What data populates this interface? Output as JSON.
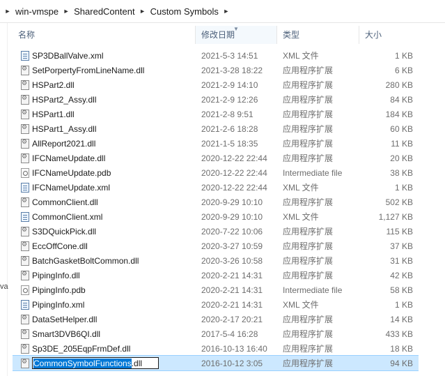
{
  "breadcrumb": [
    "win-vmspe",
    "SharedContent",
    "Custom Symbols"
  ],
  "left_fragment": "va",
  "columns": {
    "name": "名称",
    "date": "修改日期",
    "type": "类型",
    "size": "大小"
  },
  "files": [
    {
      "name": "SP3DBallValve.xml",
      "date": "2021-5-3 14:51",
      "type": "XML 文件",
      "size": "1 KB",
      "icon": "xml"
    },
    {
      "name": "SetPorpertyFromLineName.dll",
      "date": "2021-3-28 18:22",
      "type": "应用程序扩展",
      "size": "6 KB",
      "icon": "dll"
    },
    {
      "name": "HSPart2.dll",
      "date": "2021-2-9 14:10",
      "type": "应用程序扩展",
      "size": "280 KB",
      "icon": "dll"
    },
    {
      "name": "HSPart2_Assy.dll",
      "date": "2021-2-9 12:26",
      "type": "应用程序扩展",
      "size": "84 KB",
      "icon": "dll"
    },
    {
      "name": "HSPart1.dll",
      "date": "2021-2-8 9:51",
      "type": "应用程序扩展",
      "size": "184 KB",
      "icon": "dll"
    },
    {
      "name": "HSPart1_Assy.dll",
      "date": "2021-2-6 18:28",
      "type": "应用程序扩展",
      "size": "60 KB",
      "icon": "dll"
    },
    {
      "name": "AllReport2021.dll",
      "date": "2021-1-5 18:35",
      "type": "应用程序扩展",
      "size": "11 KB",
      "icon": "dll"
    },
    {
      "name": "IFCNameUpdate.dll",
      "date": "2020-12-22 22:44",
      "type": "应用程序扩展",
      "size": "20 KB",
      "icon": "dll"
    },
    {
      "name": "IFCNameUpdate.pdb",
      "date": "2020-12-22 22:44",
      "type": "Intermediate file",
      "size": "38 KB",
      "icon": "pdb"
    },
    {
      "name": "IFCNameUpdate.xml",
      "date": "2020-12-22 22:44",
      "type": "XML 文件",
      "size": "1 KB",
      "icon": "xml"
    },
    {
      "name": "CommonClient.dll",
      "date": "2020-9-29 10:10",
      "type": "应用程序扩展",
      "size": "502 KB",
      "icon": "dll"
    },
    {
      "name": "CommonClient.xml",
      "date": "2020-9-29 10:10",
      "type": "XML 文件",
      "size": "1,127 KB",
      "icon": "xml"
    },
    {
      "name": "S3DQuickPick.dll",
      "date": "2020-7-22 10:06",
      "type": "应用程序扩展",
      "size": "115 KB",
      "icon": "dll"
    },
    {
      "name": "EccOffCone.dll",
      "date": "2020-3-27 10:59",
      "type": "应用程序扩展",
      "size": "37 KB",
      "icon": "dll"
    },
    {
      "name": "BatchGasketBoltCommon.dll",
      "date": "2020-3-26 10:58",
      "type": "应用程序扩展",
      "size": "31 KB",
      "icon": "dll"
    },
    {
      "name": "PipingInfo.dll",
      "date": "2020-2-21 14:31",
      "type": "应用程序扩展",
      "size": "42 KB",
      "icon": "dll"
    },
    {
      "name": "PipingInfo.pdb",
      "date": "2020-2-21 14:31",
      "type": "Intermediate file",
      "size": "58 KB",
      "icon": "pdb"
    },
    {
      "name": "PipingInfo.xml",
      "date": "2020-2-21 14:31",
      "type": "XML 文件",
      "size": "1 KB",
      "icon": "xml"
    },
    {
      "name": "DataSetHelper.dll",
      "date": "2020-2-17 20:21",
      "type": "应用程序扩展",
      "size": "14 KB",
      "icon": "dll"
    },
    {
      "name": "Smart3DVB6QI.dll",
      "date": "2017-5-4 16:28",
      "type": "应用程序扩展",
      "size": "433 KB",
      "icon": "dll"
    },
    {
      "name": "Sp3DE_205EqpFrmDef.dll",
      "date": "2016-10-13 16:40",
      "type": "应用程序扩展",
      "size": "18 KB",
      "icon": "dll"
    }
  ],
  "selected_file": {
    "name_selected": "CommonSymbolFunctions",
    "name_rest": ".dll",
    "date": "2016-10-12 3:05",
    "type": "应用程序扩展",
    "size": "94 KB",
    "icon": "dll"
  }
}
